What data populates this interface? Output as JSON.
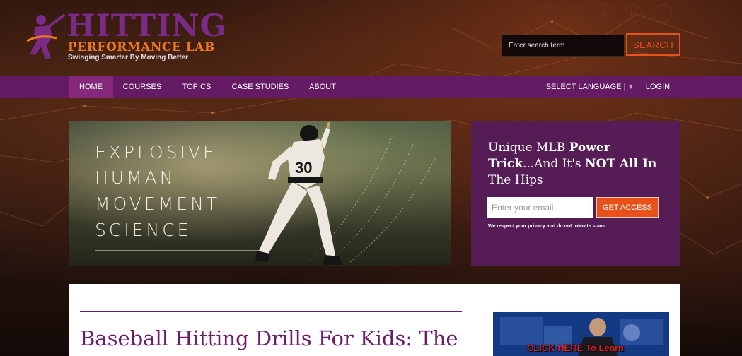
{
  "brand": {
    "name_line1": "HITTING",
    "name_line2": "PERFORMANCE LAB",
    "tagline": "Swinging Smarter By Moving Better",
    "colors": {
      "purple": "#7b2a85",
      "orange": "#f07b1f",
      "nav": "#641b64",
      "accent": "#e9511a"
    }
  },
  "social": [
    {
      "name": "twitter",
      "glyph": "𝕥"
    },
    {
      "name": "facebook",
      "glyph": "f"
    },
    {
      "name": "youtube",
      "glyph": "▶"
    },
    {
      "name": "linkedin",
      "glyph": "in"
    },
    {
      "name": "rss",
      "glyph": "◔"
    }
  ],
  "search": {
    "placeholder": "Enter search term",
    "button_label": "SEARCH"
  },
  "nav": {
    "items": [
      "HOME",
      "COURSES",
      "TOPICS",
      "CASE STUDIES",
      "ABOUT"
    ],
    "active": "HOME",
    "language_label": "SELECT LANGUAGE",
    "language_arrow": "▼",
    "login_label": "LOGIN"
  },
  "hero": {
    "words": [
      "EXPLOSIVE",
      "HUMAN",
      "MOVEMENT",
      "SCIENCE"
    ],
    "jersey_number": "30"
  },
  "optin": {
    "headline_1": "Unique MLB ",
    "headline_bold_1": "Power Trick",
    "headline_2": "...And It's ",
    "headline_bold_2": "NOT All In",
    "headline_3": " The Hips",
    "email_placeholder": "Enter your email",
    "button_label": "GET ACCESS",
    "privacy_text": "We respect your privacy and do not tolerate spam."
  },
  "article": {
    "title": "Baseball Hitting Drills For Kids: The"
  },
  "video": {
    "cta": "CLICK HERE To Learn"
  }
}
